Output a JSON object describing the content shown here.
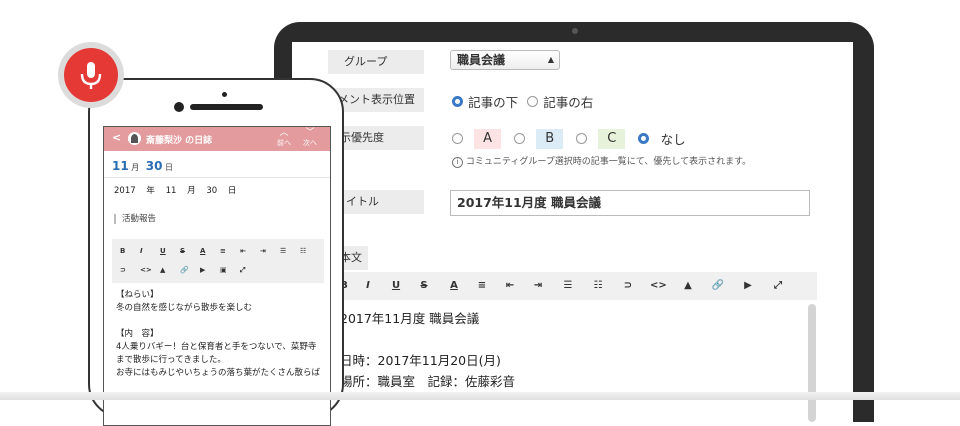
{
  "colors": {
    "accent": "#3b78c5",
    "phone_header": "#e49b9d",
    "mic": "#e53935",
    "chip_a": "#fde3e3",
    "chip_b": "#dcecf7",
    "chip_c": "#e6f2d9"
  },
  "laptop": {
    "group": {
      "label": "グループ",
      "value": "職員会議"
    },
    "comment_position": {
      "label": "メント表示位置",
      "options": [
        "記事の下",
        "記事の右"
      ],
      "selected": "記事の下"
    },
    "priority": {
      "label": "示優先度",
      "options": [
        "A",
        "B",
        "C",
        "なし"
      ],
      "selected": "なし",
      "note": "コミュニティグループ選択時の記事一覧にて、優先して表示されます。"
    },
    "title": {
      "label": "イトル",
      "value": "2017年11月度 職員会議"
    },
    "body_label": "本文",
    "toolbar": [
      "B",
      "I",
      "U",
      "S",
      "A",
      "≡",
      "⇤",
      "⇥",
      "☰",
      "☷",
      "⊃",
      "<>",
      "▲",
      "🔗",
      "▶",
      "⤢"
    ],
    "body_lines": [
      "2017年11月度 職員会議",
      "",
      "日時：2017年11月20日(月)",
      "場所：職員室　記録：佐藤彩音"
    ]
  },
  "phone": {
    "header": {
      "back": "<",
      "title": "斎藤梨沙 の日誌",
      "prev": "前へ",
      "next": "次へ"
    },
    "date_display": {
      "month": "11",
      "month_unit": "月",
      "day": "30",
      "day_unit": "日"
    },
    "date_fields": {
      "year": "2017",
      "year_unit": "年",
      "month": "11",
      "month_unit": "月",
      "day": "30",
      "day_unit": "日"
    },
    "category": "活動報告",
    "toolbar_row1": [
      "B",
      "I",
      "U",
      "S",
      "A",
      "≡",
      "⇤",
      "⇥",
      "☰",
      "☷"
    ],
    "toolbar_row2": [
      "⊃",
      "<>",
      "▲",
      "🔗",
      "▶",
      "▣",
      "⤢"
    ],
    "body_lines": [
      "【ねらい】",
      "冬の自然を感じながら散歩を楽しむ",
      "",
      "【内　容】",
      "4人乗りバギー！台と保育者と手をつないで、菜野寺",
      "まで散歩に行ってきました。",
      "お寺にはもみじやいちょうの落ち葉がたくさん散らば"
    ]
  }
}
